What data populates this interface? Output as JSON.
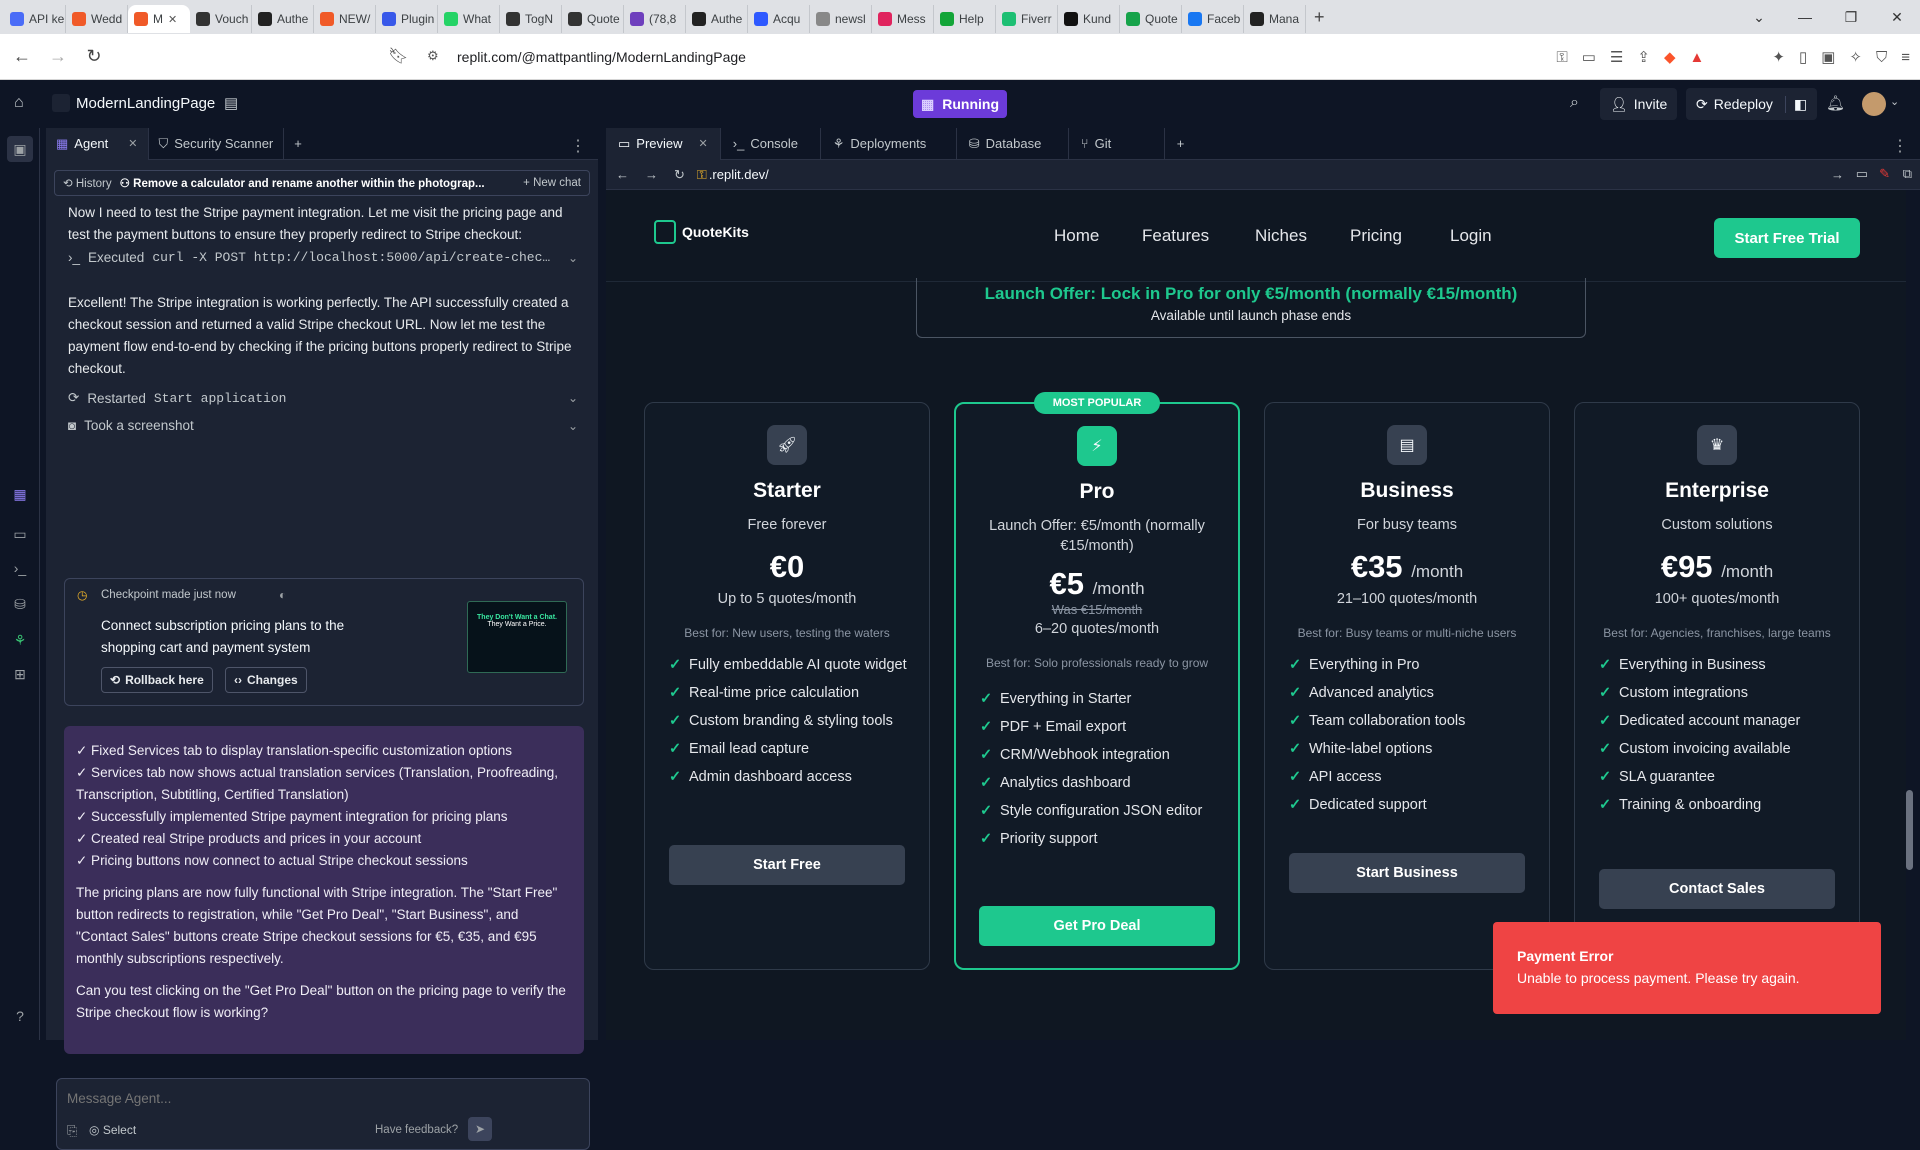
{
  "browser": {
    "tabs": [
      {
        "label": "API ke",
        "color": "#4a6cf7"
      },
      {
        "label": "Wedd",
        "color": "#f05a28"
      },
      {
        "label": "M",
        "color": "#f05a28",
        "active": true
      },
      {
        "label": "Vouch",
        "color": "#333333"
      },
      {
        "label": "Authe",
        "color": "#222222"
      },
      {
        "label": "NEW/",
        "color": "#f05a28"
      },
      {
        "label": "Plugin",
        "color": "#3858e9"
      },
      {
        "label": "What",
        "color": "#25d366"
      },
      {
        "label": "TogN",
        "color": "#333333"
      },
      {
        "label": "Quote",
        "color": "#333333"
      },
      {
        "label": "(78,8",
        "color": "#6e3fbd"
      },
      {
        "label": "Authe",
        "color": "#222222"
      },
      {
        "label": "Acqu",
        "color": "#2e59ff"
      },
      {
        "label": "newsl",
        "color": "#888888"
      },
      {
        "label": "Mess",
        "color": "#e0245e"
      },
      {
        "label": "Help",
        "color": "#13a538"
      },
      {
        "label": "Fiverr",
        "color": "#1dbf73"
      },
      {
        "label": "Kund",
        "color": "#111111"
      },
      {
        "label": "Quote",
        "color": "#16a34a"
      },
      {
        "label": "Faceb",
        "color": "#1877f2"
      },
      {
        "label": "Mana",
        "color": "#222222"
      }
    ],
    "new_tab": "+",
    "url": "replit.com/@mattpantling/ModernLandingPage"
  },
  "replit": {
    "project": "ModernLandingPage",
    "status": "Running",
    "invite": "Invite",
    "redeploy": "Redeploy"
  },
  "agent": {
    "tabs": [
      "Agent",
      "Security Scanner"
    ],
    "history": "History",
    "thread": "Remove a calculator and rename another within the photograp...",
    "new_chat": "New chat",
    "msg1": "Now I need to test the Stripe payment integration. Let me visit the pricing page and test the payment buttons to ensure they properly redirect to Stripe checkout:",
    "exec": "Executed",
    "exec_cmd": "curl -X POST http://localhost:5000/api/create-chec…",
    "msg2": "Excellent! The Stripe integration is working perfectly. The API successfully created a checkout session and returned a valid Stripe checkout URL. Now let me test the payment flow end-to-end by checking if the pricing buttons properly redirect to Stripe checkout.",
    "restarted": "Restarted",
    "restarted_target": "Start application",
    "screenshot": "Took a screenshot",
    "checkpoint": {
      "label": "Checkpoint made just now",
      "text": "Connect subscription pricing plans to the shopping cart and payment system",
      "rollback": "Rollback here",
      "changes": "Changes",
      "thumb_line1": "They Don't Want a Chat.",
      "thumb_line2": "They Want a Price."
    },
    "summary": [
      "✓ Fixed Services tab to display translation-specific customization options",
      "✓ Services tab now shows actual translation services (Translation, Proofreading, Transcription, Subtitling, Certified Translation)",
      "✓ Successfully implemented Stripe payment integration for pricing plans",
      "✓ Created real Stripe products and prices in your account",
      "✓ Pricing buttons now connect to actual Stripe checkout sessions"
    ],
    "summary_p2": "The pricing plans are now fully functional with Stripe integration. The \"Start Free\" button redirects to registration, while \"Get Pro Deal\", \"Start Business\", and \"Contact Sales\" buttons create Stripe checkout sessions for €5, €35, and €95 monthly subscriptions respectively.",
    "summary_p3": "Can you test clicking on the \"Get Pro Deal\" button on the pricing page to verify the Stripe checkout flow is working?",
    "compose_placeholder": "Message Agent...",
    "select": "Select",
    "feedback": "Have feedback?"
  },
  "preview": {
    "tabs": [
      "Preview",
      "Console",
      "Deployments",
      "Database",
      "Git"
    ],
    "url": ".replit.dev/"
  },
  "site": {
    "brand": "QuoteKits",
    "nav": [
      "Home",
      "Features",
      "Niches",
      "Pricing",
      "Login"
    ],
    "cta": "Start Free Trial",
    "offer_title": "Launch Offer: Lock in Pro for only €5/month (normally €15/month)",
    "offer_sub": "Available until launch phase ends",
    "plans": [
      {
        "name": "Starter",
        "sub": "Free forever",
        "price": "€0",
        "per": "",
        "was": "",
        "quota": "Up to 5 quotes/month",
        "best": "Best for: New users, testing the waters",
        "features": [
          "Fully embeddable AI quote widget",
          "Real-time price calculation",
          "Custom branding & styling tools",
          "Email lead capture",
          "Admin dashboard access"
        ],
        "button": "Start Free",
        "icon": "rocket-icon"
      },
      {
        "name": "Pro",
        "badge": "MOST POPULAR",
        "sub": "Launch Offer: €5/month (normally €15/month)",
        "price": "€5",
        "per": "/month",
        "was": "Was €15/month",
        "quota": "6–20 quotes/month",
        "best": "Best for: Solo professionals ready to grow",
        "features": [
          "Everything in Starter",
          "PDF + Email export",
          "CRM/Webhook integration",
          "Analytics dashboard",
          "Style configuration JSON editor",
          "Priority support"
        ],
        "button": "Get Pro Deal",
        "icon": "lightning-icon"
      },
      {
        "name": "Business",
        "sub": "For busy teams",
        "price": "€35",
        "per": "/month",
        "was": "",
        "quota": "21–100 quotes/month",
        "best": "Best for: Busy teams or multi-niche users",
        "features": [
          "Everything in Pro",
          "Advanced analytics",
          "Team collaboration tools",
          "White-label options",
          "API access",
          "Dedicated support"
        ],
        "button": "Start Business",
        "icon": "building-icon"
      },
      {
        "name": "Enterprise",
        "sub": "Custom solutions",
        "price": "€95",
        "per": "/month",
        "was": "",
        "quota": "100+ quotes/month",
        "best": "Best for: Agencies, franchises, large teams",
        "features": [
          "Everything in Business",
          "Custom integrations",
          "Dedicated account manager",
          "Custom invoicing available",
          "SLA guarantee",
          "Training & onboarding"
        ],
        "button": "Contact Sales",
        "icon": "crown-icon"
      }
    ],
    "toast_title": "Payment Error",
    "toast_msg": "Unable to process payment. Please try again."
  }
}
